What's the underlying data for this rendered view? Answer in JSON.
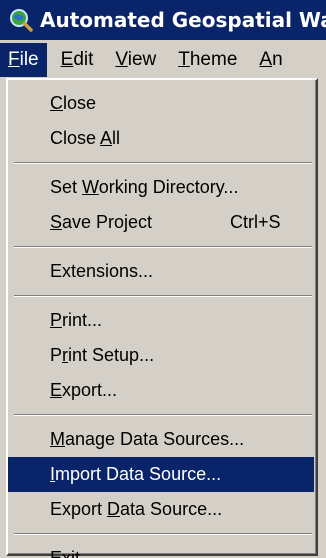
{
  "window": {
    "title": "Automated Geospatial Wa"
  },
  "menubar": {
    "items": [
      {
        "pre": "",
        "acc": "F",
        "post": "ile"
      },
      {
        "pre": "",
        "acc": "E",
        "post": "dit"
      },
      {
        "pre": "",
        "acc": "V",
        "post": "iew"
      },
      {
        "pre": "",
        "acc": "T",
        "post": "heme"
      },
      {
        "pre": "",
        "acc": "A",
        "post": "n"
      }
    ]
  },
  "file_menu": {
    "close": {
      "pre": "",
      "acc": "C",
      "post": "lose"
    },
    "close_all": {
      "pre": "Close ",
      "acc": "A",
      "post": "ll"
    },
    "set_wd": {
      "pre": "Set ",
      "acc": "W",
      "post": "orking Directory..."
    },
    "save": {
      "pre": "",
      "acc": "S",
      "post": "ave Project",
      "shortcut": "Ctrl+S"
    },
    "extensions": {
      "pre": "Extensions...",
      "acc": "",
      "post": ""
    },
    "print": {
      "pre": "",
      "acc": "P",
      "post": "rint..."
    },
    "print_setup": {
      "pre": "P",
      "acc": "r",
      "post": "int Setup..."
    },
    "export": {
      "pre": "",
      "acc": "E",
      "post": "xport..."
    },
    "manage_ds": {
      "pre": "",
      "acc": "M",
      "post": "anage Data Sources..."
    },
    "import_ds": {
      "pre": "",
      "acc": "I",
      "post": "mport Data Source..."
    },
    "export_ds": {
      "pre": "Export ",
      "acc": "D",
      "post": "ata Source..."
    },
    "exit": {
      "pre": "E",
      "acc": "x",
      "post": "it"
    }
  }
}
